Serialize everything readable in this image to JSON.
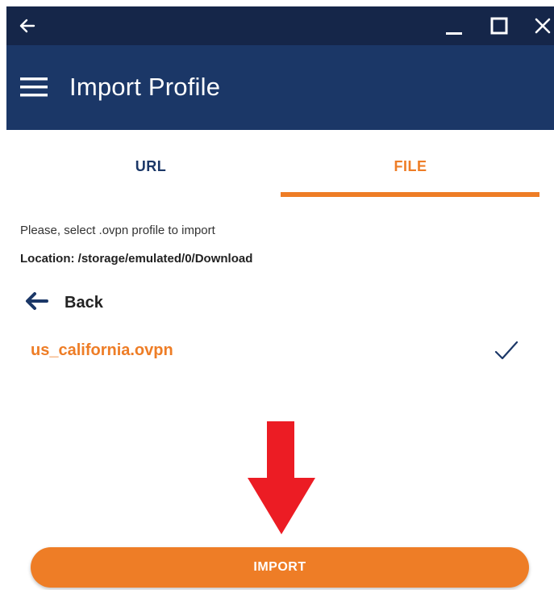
{
  "window": {
    "back_icon": "arrow-left-icon",
    "minimize_icon": "minimize-icon",
    "maximize_icon": "maximize-icon",
    "close_icon": "close-icon"
  },
  "appbar": {
    "menu_icon": "hamburger-icon",
    "title": "Import Profile"
  },
  "tabs": [
    {
      "label": "URL",
      "active": false
    },
    {
      "label": "FILE",
      "active": true
    }
  ],
  "content": {
    "instruction": "Please, select .ovpn profile to import",
    "location": "Location: /storage/emulated/0/Download",
    "back_label": "Back",
    "back_icon": "arrow-left-icon",
    "files": [
      {
        "name": "us_california.ovpn",
        "selected": true,
        "check_icon": "check-icon"
      }
    ]
  },
  "import_button": {
    "label": "IMPORT"
  },
  "annotation": {
    "icon": "red-down-arrow-icon"
  },
  "colors": {
    "titlebar": "#152649",
    "appbar": "#1b3767",
    "accent": "#ee7d26",
    "annotation_red": "#ec1c24"
  }
}
